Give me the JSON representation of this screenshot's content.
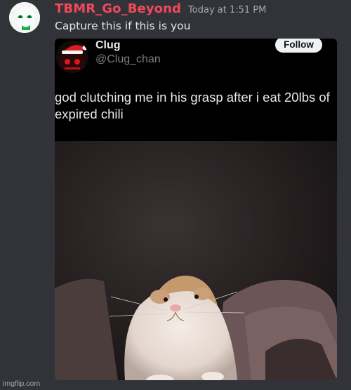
{
  "message": {
    "username": "TBMR_Go_Beyond",
    "timestamp": "Today at 1:51 PM",
    "content": "Capture this if this is you"
  },
  "tweet": {
    "display_name": "Clug",
    "handle": "@Clug_chan",
    "follow_label": "Follow",
    "text_line1": "god clutching me in his grasp after i eat 20lbs of",
    "text_line2": "expired chili"
  },
  "watermark": "imgflip.com",
  "colors": {
    "background": "#323339",
    "username": "#f0495b",
    "timestamp": "#a4a7b0",
    "message_text": "#e3e5e8"
  },
  "icons": {
    "user_avatar": "green-eyed-white-face-avatar",
    "tweet_avatar": "santa-hat-red-face-avatar",
    "photo": "hamster-photo"
  }
}
